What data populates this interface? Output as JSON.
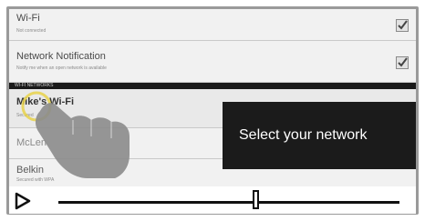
{
  "settings": {
    "wifi": {
      "title": "Wi-Fi",
      "subtitle": "Not connected",
      "checked": true
    },
    "network_notification": {
      "title": "Network Notification",
      "subtitle": "Notify me when an open network is available",
      "checked": true
    },
    "section_header": "WI-FI NETWORKS",
    "networks": [
      {
        "name": "Mike's Wi-Fi",
        "status": "Secured"
      },
      {
        "name": "McLen"
      },
      {
        "name": "Belkin",
        "status": "Secured with WPA"
      }
    ]
  },
  "callout": {
    "text": "Select your network"
  },
  "player": {
    "play_icon": "play-icon",
    "progress": 0.58
  },
  "colors": {
    "frame": "#9a9a9a",
    "callout_bg": "#1b1b1b",
    "highlight": "#e8d24a"
  }
}
